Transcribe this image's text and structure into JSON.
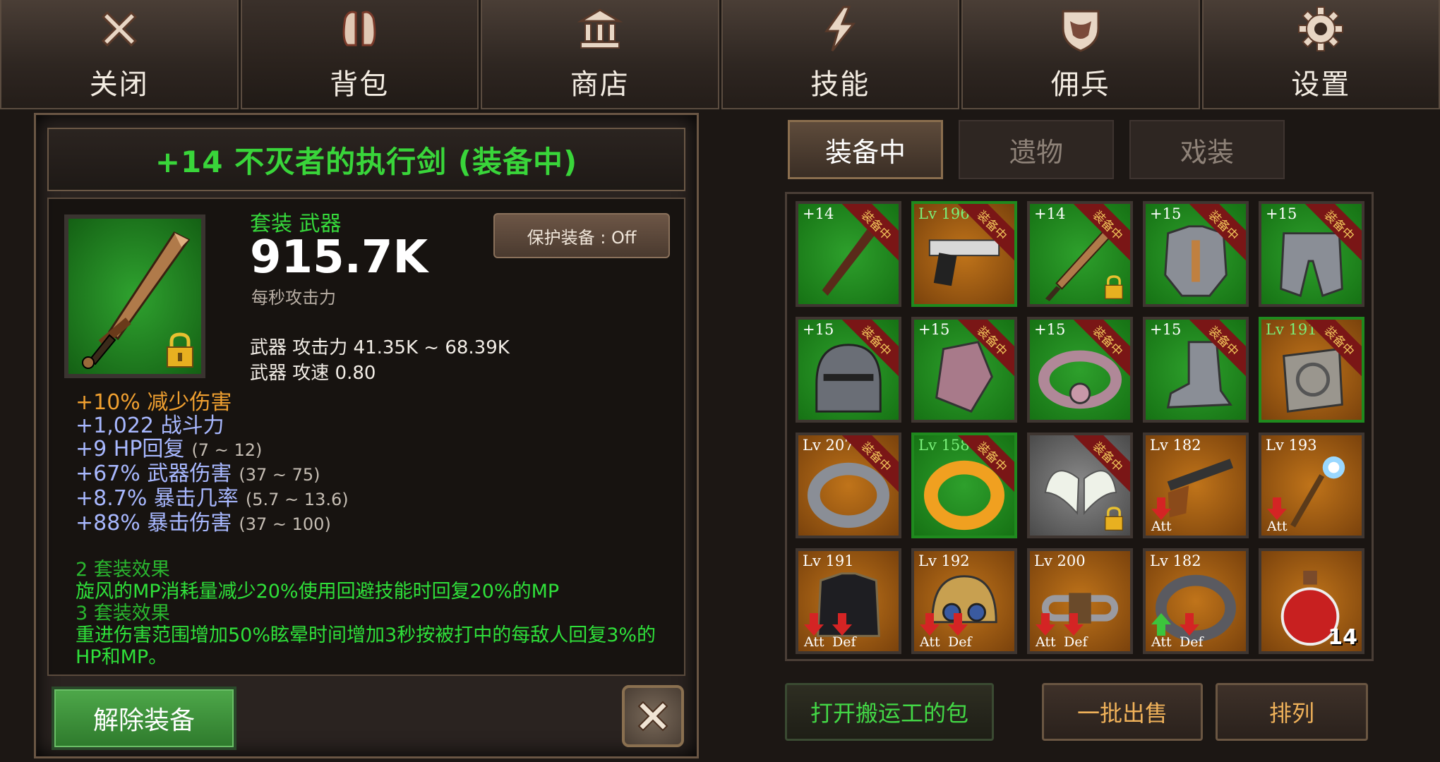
{
  "nav": [
    {
      "label": "关闭",
      "icon": "close-x-icon"
    },
    {
      "label": "背包",
      "icon": "backpack-icon"
    },
    {
      "label": "商店",
      "icon": "shop-bank-icon"
    },
    {
      "label": "技能",
      "icon": "lightning-skill-icon"
    },
    {
      "label": "佣兵",
      "icon": "shield-mercenary-icon"
    },
    {
      "label": "设置",
      "icon": "gear-icon"
    }
  ],
  "item": {
    "title": "+14 不灭者的执行剑 (装备中)",
    "set_type": "套装 武器",
    "dps": "915.7K",
    "dps_label": "每秒攻击力",
    "protect_label": "保护装备 : Off",
    "weapon_attack": "武器 攻击力 41.35K ~ 68.39K",
    "weapon_speed": "武器 攻速 0.80",
    "stats": [
      {
        "value": "+10%",
        "name": "减少伤害",
        "range": "",
        "color": "#f0a030"
      },
      {
        "value": "+1,022",
        "name": "战斗力",
        "range": "",
        "color": "#a8b8ff"
      },
      {
        "value": "+9",
        "name": "HP回复",
        "range": "(7 ~ 12)",
        "color": "#a8b8ff"
      },
      {
        "value": "+67%",
        "name": "武器伤害",
        "range": "(37 ~ 75)",
        "color": "#a8b8ff"
      },
      {
        "value": "+8.7%",
        "name": "暴击几率",
        "range": "(5.7 ~ 13.6)",
        "color": "#a8b8ff"
      },
      {
        "value": "+88%",
        "name": "暴击伤害",
        "range": "(37 ~ 100)",
        "color": "#a8b8ff"
      }
    ],
    "set2_header": "2 套装效果",
    "set2_text": "旋风的MP消耗量减少20%使用回避技能时回复20%的MP",
    "set3_header": "3 套装效果",
    "set3_text": "重进伤害范围增加50%眩晕时间增加3秒按被打中的每敌人回复3%的HP和MP。",
    "unequip_label": "解除装备"
  },
  "tabs": [
    "装备中",
    "遗物",
    "戏装"
  ],
  "equipped_ribbon": "装备中",
  "slots": [
    {
      "level": "+14",
      "bg": "green",
      "ribbon": true,
      "icon": "axe-weapon-icon"
    },
    {
      "level": "Lv 196",
      "bg": "orange",
      "ribbon": true,
      "gborder": true,
      "icon": "pistol-icon"
    },
    {
      "level": "+14",
      "bg": "green",
      "ribbon": true,
      "lock": true,
      "icon": "sword-icon"
    },
    {
      "level": "+15",
      "bg": "green",
      "ribbon": true,
      "icon": "chest-armor-icon"
    },
    {
      "level": "+15",
      "bg": "green",
      "ribbon": true,
      "icon": "leg-armor-icon"
    },
    {
      "level": "+15",
      "bg": "green",
      "ribbon": true,
      "icon": "helmet-icon"
    },
    {
      "level": "+15",
      "bg": "green",
      "ribbon": true,
      "icon": "gauntlet-icon"
    },
    {
      "level": "+15",
      "bg": "green",
      "ribbon": true,
      "icon": "belt-icon"
    },
    {
      "level": "+15",
      "bg": "green",
      "ribbon": true,
      "icon": "boots-icon"
    },
    {
      "level": "Lv 191",
      "bg": "orange",
      "ribbon": true,
      "gborder": true,
      "icon": "amulet-icon"
    },
    {
      "level": "Lv 207",
      "bg": "orange",
      "ribbon": true,
      "icon": "silver-ring-icon"
    },
    {
      "level": "Lv 158",
      "bg": "green",
      "ribbon": true,
      "gborder": true,
      "icon": "gold-ring-icon"
    },
    {
      "level": "",
      "bg": "gray",
      "ribbon": true,
      "lock": true,
      "icon": "wings-icon"
    },
    {
      "level": "Lv 182",
      "bg": "orange",
      "att": "Att",
      "att_dir": "down",
      "icon": "shotgun-icon"
    },
    {
      "level": "Lv 193",
      "bg": "orange",
      "att": "Att",
      "att_dir": "down",
      "icon": "magic-wand-icon"
    },
    {
      "level": "Lv 191",
      "bg": "orange",
      "att": "Att",
      "att_dir": "down",
      "def": "Def",
      "def_dir": "down",
      "icon": "black-armor-icon"
    },
    {
      "level": "Lv 192",
      "bg": "orange",
      "att": "Att",
      "att_dir": "down",
      "def": "Def",
      "def_dir": "down",
      "icon": "goggle-helmet-icon"
    },
    {
      "level": "Lv 200",
      "bg": "orange",
      "att": "Att",
      "att_dir": "down",
      "def": "Def",
      "def_dir": "down",
      "icon": "chain-belt-icon"
    },
    {
      "level": "Lv 182",
      "bg": "orange",
      "att": "Att",
      "att_dir": "up",
      "def": "Def",
      "def_dir": "down",
      "icon": "dark-ring-icon"
    },
    {
      "level": "",
      "bg": "orange",
      "count": "14",
      "icon": "red-potion-icon"
    }
  ],
  "bottom": {
    "porter_bag": "打开搬运工的包",
    "bulk_sell": "一批出售",
    "sort": "排列"
  },
  "colors": {
    "green_text": "#39d53a",
    "gold_text": "#f0b25a",
    "arrow_red": "#d42424",
    "arrow_green": "#3cc43c"
  }
}
